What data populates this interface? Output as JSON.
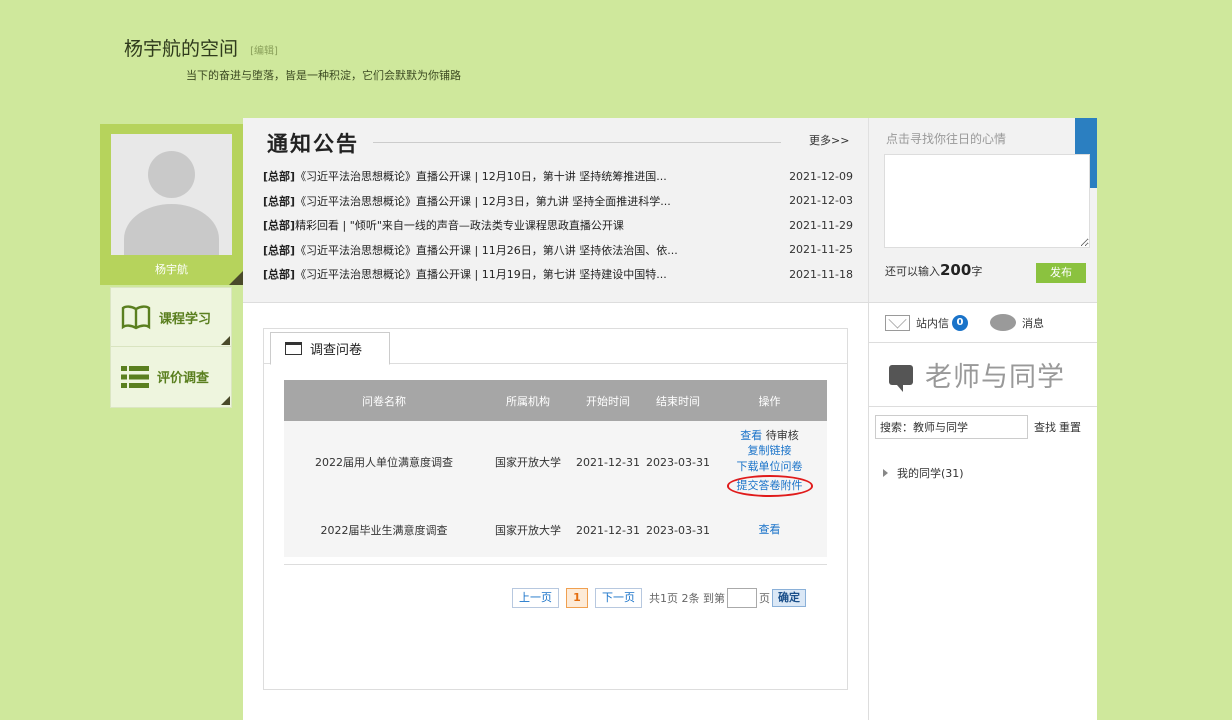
{
  "header": {
    "space_title": "杨宇航的空间",
    "edit_label": "[编辑]",
    "motto": "当下的奋进与堕落，皆是一种积淀，它们会默默为你铺路"
  },
  "profile": {
    "name": "杨宇航"
  },
  "nav": [
    {
      "label": "课程学习",
      "icon": "open-book-icon"
    },
    {
      "label": "评价调查",
      "icon": "list-icon"
    }
  ],
  "notice": {
    "title": "通知公告",
    "more": "更多>>",
    "items": [
      {
        "tag": "[总部]",
        "text": "《习近平法治思想概论》直播公开课 | 12月10日，第十讲 坚持统筹推进国...",
        "date": "2021-12-09"
      },
      {
        "tag": "[总部]",
        "text": "《习近平法治思想概论》直播公开课 | 12月3日，第九讲 坚持全面推进科学...",
        "date": "2021-12-03"
      },
      {
        "tag": "[总部]",
        "text": "精彩回看 | \"倾听\"来自一线的声音—政法类专业课程思政直播公开课",
        "date": "2021-11-29"
      },
      {
        "tag": "[总部]",
        "text": "《习近平法治思想概论》直播公开课 | 11月26日，第八讲 坚持依法治国、依...",
        "date": "2021-11-25"
      },
      {
        "tag": "[总部]",
        "text": "《习近平法治思想概论》直播公开课 | 11月19日，第七讲 坚持建设中国特...",
        "date": "2021-11-18"
      }
    ]
  },
  "mood": {
    "hint": "点击寻找你往日的心情",
    "remaining_prefix": "还可以输入",
    "remaining_count": "200",
    "remaining_suffix": "字",
    "publish": "发布"
  },
  "survey": {
    "tab_label": "调查问卷",
    "columns": [
      "问卷名称",
      "所属机构",
      "开始时间",
      "结束时间",
      "操作"
    ],
    "rows": [
      {
        "name": "2022届用人单位满意度调查",
        "org": "国家开放大学",
        "start": "2021-12-31",
        "end": "2023-03-31",
        "view": "查看",
        "status": "待审核",
        "copy_link": "复制链接",
        "download": "下载单位问卷",
        "submit_attachment": "提交答卷附件"
      },
      {
        "name": "2022届毕业生满意度调查",
        "org": "国家开放大学",
        "start": "2021-12-31",
        "end": "2023-03-31",
        "view": "查看"
      }
    ],
    "annotation_color": "#e01b1b"
  },
  "pager": {
    "prev": "上一页",
    "current": "1",
    "next": "下一页",
    "summary": "共1页 2条 到第",
    "page_suffix": "页",
    "confirm": "确定"
  },
  "right": {
    "inbox": "站内信",
    "inbox_count": "0",
    "messages": "消息",
    "teachers_title": "老师与同学",
    "search_value": "搜索：教师与同学",
    "search": "查找",
    "reset": "重置",
    "classmates": "我的同学(31)"
  }
}
